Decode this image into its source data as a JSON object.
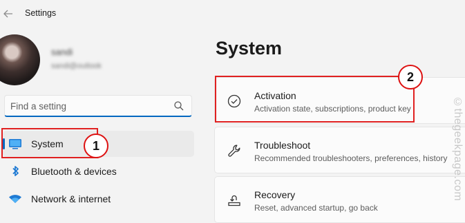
{
  "window": {
    "title": "Settings"
  },
  "user": {
    "name": "sandi",
    "email": "sandi@outlook"
  },
  "search": {
    "placeholder": "Find a setting",
    "value": ""
  },
  "nav": {
    "items": [
      {
        "label": "System",
        "selected": true
      },
      {
        "label": "Bluetooth & devices",
        "selected": false
      },
      {
        "label": "Network & internet",
        "selected": false
      }
    ]
  },
  "main": {
    "title": "System",
    "cards": [
      {
        "title": "Activation",
        "subtitle": "Activation state, subscriptions, product key",
        "icon": "check-circle-icon"
      },
      {
        "title": "Troubleshoot",
        "subtitle": "Recommended troubleshooters, preferences, history",
        "icon": "wrench-icon"
      },
      {
        "title": "Recovery",
        "subtitle": "Reset, advanced startup, go back",
        "icon": "recovery-icon"
      }
    ]
  },
  "annotations": {
    "badge1": "1",
    "badge2": "2",
    "highlight_color": "#e02020"
  },
  "watermark": "©thegeekpage.com",
  "colors": {
    "accent": "#0067c0",
    "annotation_red": "#e02020"
  }
}
